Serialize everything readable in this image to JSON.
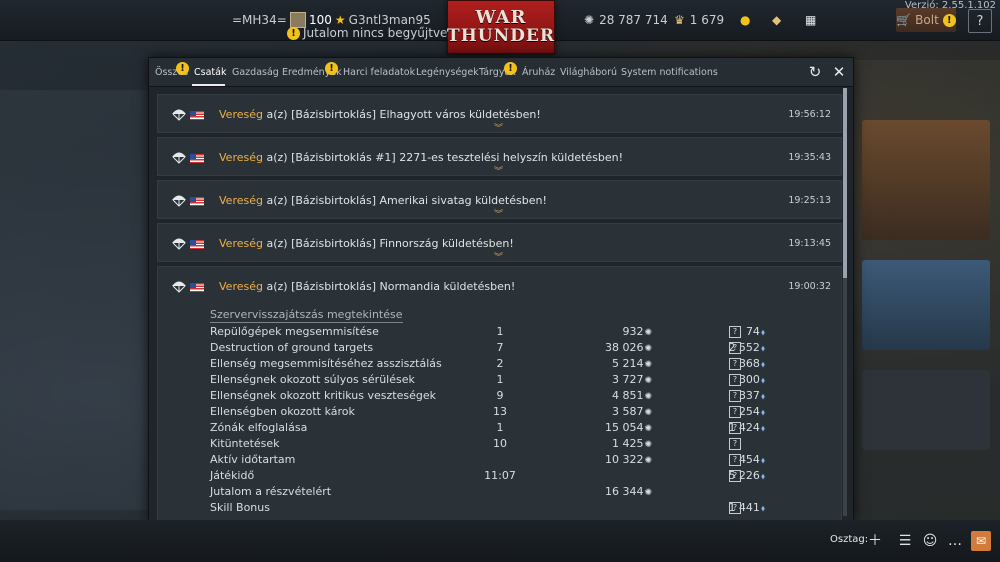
{
  "version": "Verzió: 2.55.1.102",
  "topbar": {
    "squad_tag": "=MH34=",
    "level": "100",
    "username": "G3ntl3man95",
    "reward_notice": "Jutalom nincs begyűjtve",
    "logo_line1": "WAR",
    "logo_line2": "THUNDER",
    "silver_lions": "28 787 714",
    "golden_eagles": "1 679",
    "shop_label": "Bolt",
    "help_label": "?"
  },
  "tabs": [
    {
      "label": "Összes",
      "badge": "!"
    },
    {
      "label": "Csaták",
      "active": true
    },
    {
      "label": "Gazdaság"
    },
    {
      "label": "Eredmények",
      "badge": "!"
    },
    {
      "label": "Harci feladatok"
    },
    {
      "label": "Legénységek"
    },
    {
      "label": "Tárgyak",
      "badge": "!"
    },
    {
      "label": "Áruház"
    },
    {
      "label": "Világháború"
    },
    {
      "label": "System notifications"
    }
  ],
  "icons": {
    "refresh": "refresh-icon",
    "close": "close-icon",
    "parachute": "parachute-icon",
    "flag": "usa-flag-icon",
    "lions": "silver-lions-icon",
    "rp": "research-points-icon"
  },
  "entries": [
    {
      "result": "Vereség",
      "text": "a(z) [Bázisbirtoklás] Elhagyott város küldetésben!",
      "time": "19:56:12"
    },
    {
      "result": "Vereség",
      "text": "a(z) [Bázisbirtoklás #1] 2271-es tesztelési helyszín küldetésben!",
      "time": "19:35:43"
    },
    {
      "result": "Vereség",
      "text": "a(z) [Bázisbirtoklás] Amerikai sivatag küldetésben!",
      "time": "19:25:13"
    },
    {
      "result": "Vereség",
      "text": "a(z) [Bázisbirtoklás] Finnország küldetésben!",
      "time": "19:13:45"
    },
    {
      "result": "Vereség",
      "text": "a(z) [Bázisbirtoklás] Normandia küldetésben!",
      "time": "19:00:32"
    }
  ],
  "details": {
    "replay_link": "Szervervisszajátszás megtekintése",
    "rows": [
      {
        "label": "Repülőgépek megsemmisítése",
        "count": "1",
        "lions": "932",
        "rp": "74"
      },
      {
        "label": "Destruction of ground targets",
        "count": "7",
        "lions": "38 026",
        "rp": "2 552"
      },
      {
        "label": "Ellenség megsemmisítéséhez asszisztálás",
        "count": "2",
        "lions": "5 214",
        "rp": "368"
      },
      {
        "label": "Ellenségnek okozott súlyos sérülések",
        "count": "1",
        "lions": "3 727",
        "rp": "300"
      },
      {
        "label": "Ellenségnek okozott kritikus veszteségek",
        "count": "9",
        "lions": "4 851",
        "rp": "337"
      },
      {
        "label": "Ellenségben okozott károk",
        "count": "13",
        "lions": "3 587",
        "rp": "254"
      },
      {
        "label": "Zónák elfoglalása",
        "count": "1",
        "lions": "15 054",
        "rp": "1 424"
      },
      {
        "label": "Kitüntetések",
        "count": "10",
        "lions": "1 425",
        "rp": ""
      },
      {
        "label": "Aktív időtartam",
        "count": "",
        "lions": "10 322",
        "rp": "454"
      },
      {
        "label": "Játékidő",
        "count": "11:07",
        "lions": "",
        "rp": "5 226"
      },
      {
        "label": "Jutalom a részvételért",
        "count": "",
        "lions": "16 344",
        "rp": ""
      },
      {
        "label": "Skill Bonus",
        "count": "",
        "lions": "",
        "rp": "1 441"
      }
    ]
  },
  "bottombar": {
    "squad_label": "Osztag:"
  }
}
